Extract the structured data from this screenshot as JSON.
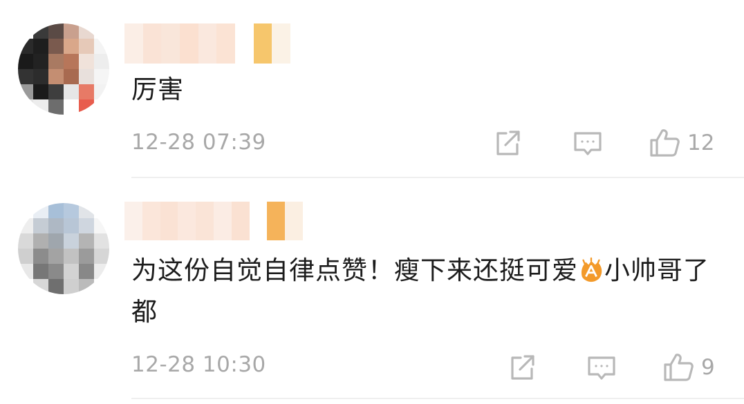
{
  "comments": [
    {
      "text": "厉害",
      "time": "12-28 07:39",
      "likes": "12",
      "share_icon": "share-icon",
      "reply_icon": "comment-icon",
      "like_icon": "thumbs-up-icon"
    },
    {
      "text_before_emoji": "为这份自觉自律点赞！瘦下来还挺可爱",
      "emoji": "clapping-hands-emoji",
      "text_after_emoji": "小帅哥了都",
      "time": "12-28 10:30",
      "likes": "9",
      "share_icon": "share-icon",
      "reply_icon": "comment-icon",
      "like_icon": "thumbs-up-icon"
    }
  ],
  "colors": {
    "text": "#1c1c1c",
    "meta": "#a8a8a8",
    "divider": "#efefef",
    "badge": "#f0a64a"
  }
}
